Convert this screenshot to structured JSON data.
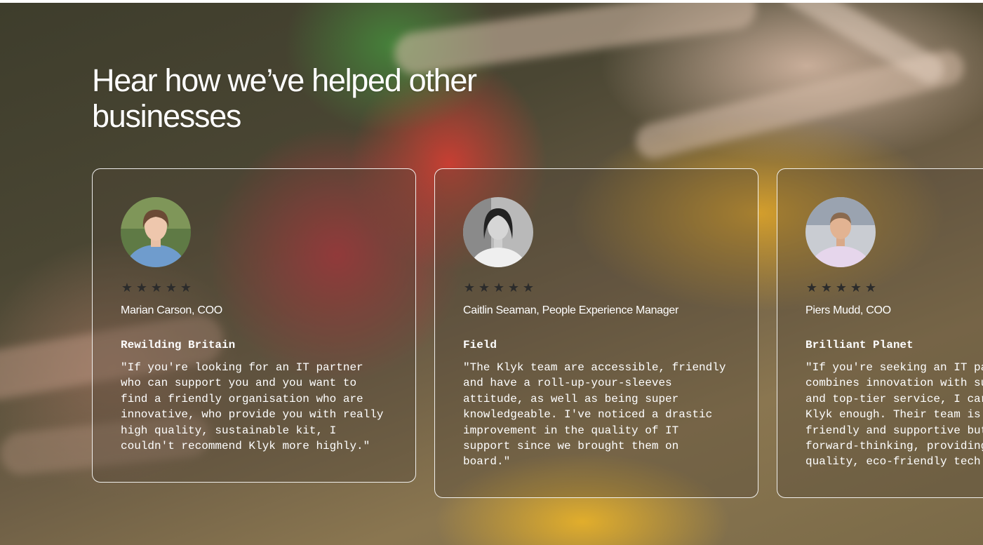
{
  "section": {
    "heading": "Hear how we’ve helped other businesses"
  },
  "testimonials": [
    {
      "avatar": "avatar-photo",
      "rating": 5,
      "stars": [
        "★",
        "★",
        "★",
        "★",
        "★"
      ],
      "name": "Marian Carson, COO",
      "company": "Rewilding Britain",
      "quote": "\"If you're looking for an IT partner\nwho can support you and you want to\nfind a friendly organisation who are\ninnovative, who provide you with really\nhigh quality, sustainable kit, I\ncouldn't recommend Klyk more highly.\""
    },
    {
      "avatar": "avatar-photo",
      "rating": 5,
      "stars": [
        "★",
        "★",
        "★",
        "★",
        "★"
      ],
      "name": "Caitlin Seaman, People Experience Manager",
      "company": "Field",
      "quote": "\"The Klyk team are accessible, friendly\nand have a roll-up-your-sleeves\nattitude, as well as being super\nknowledgeable. I've noticed a drastic\nimprovement in the quality of IT\nsupport since we brought them on\nboard.\""
    },
    {
      "avatar": "avatar-photo",
      "rating": 5,
      "stars": [
        "★",
        "★",
        "★",
        "★",
        "★"
      ],
      "name": "Piers Mudd, COO",
      "company": "Brilliant Planet",
      "quote": "\"If you're seeking an IT pa\ncombines innovation with su\nand top-tier service, I car\nKlyk enough. Their team is\nfriendly and supportive but\nforward-thinking, providing\nquality, eco-friendly tech"
    }
  ]
}
